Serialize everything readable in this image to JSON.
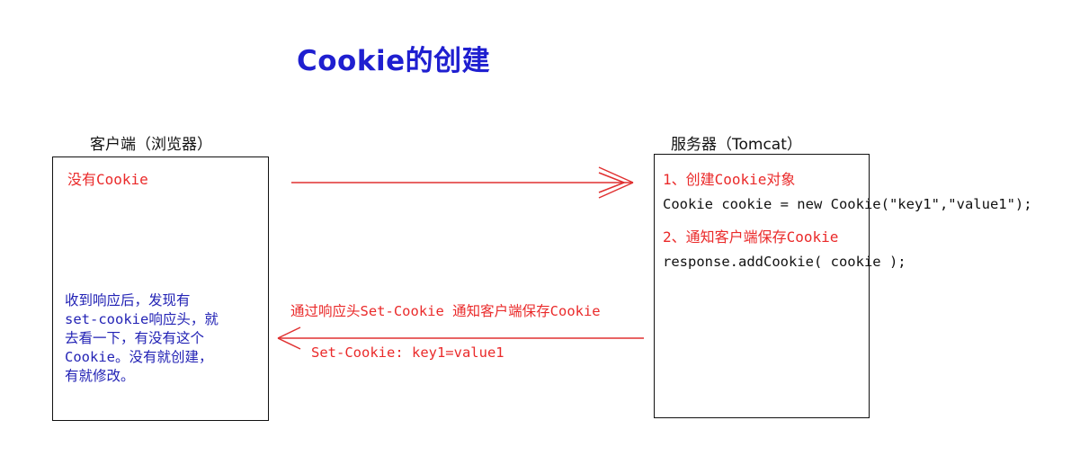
{
  "title": "Cookie的创建",
  "client": {
    "label": "客户端（浏览器）",
    "status": "没有Cookie",
    "note_lines": [
      "收到响应后，发现有",
      "set-cookie响应头，就",
      "去看一下，有没有这个",
      "Cookie。没有就创建，",
      "有就修改。"
    ]
  },
  "server": {
    "label": "服务器（Tomcat）",
    "step1": "1、创建Cookie对象",
    "code1": "Cookie cookie = new Cookie(\"key1\",\"value1\");",
    "step2": "2、通知客户端保存Cookie",
    "code2": "response.addCookie( cookie );"
  },
  "response": {
    "description": "通过响应头Set-Cookie 通知客户端保存Cookie",
    "header": "Set-Cookie: key1=value1"
  },
  "colors": {
    "title": "#1f1fd0",
    "red_text": "#ea2a2a",
    "blue_text": "#2323b5",
    "arrow": "#e03030",
    "box_border": "#111111"
  }
}
